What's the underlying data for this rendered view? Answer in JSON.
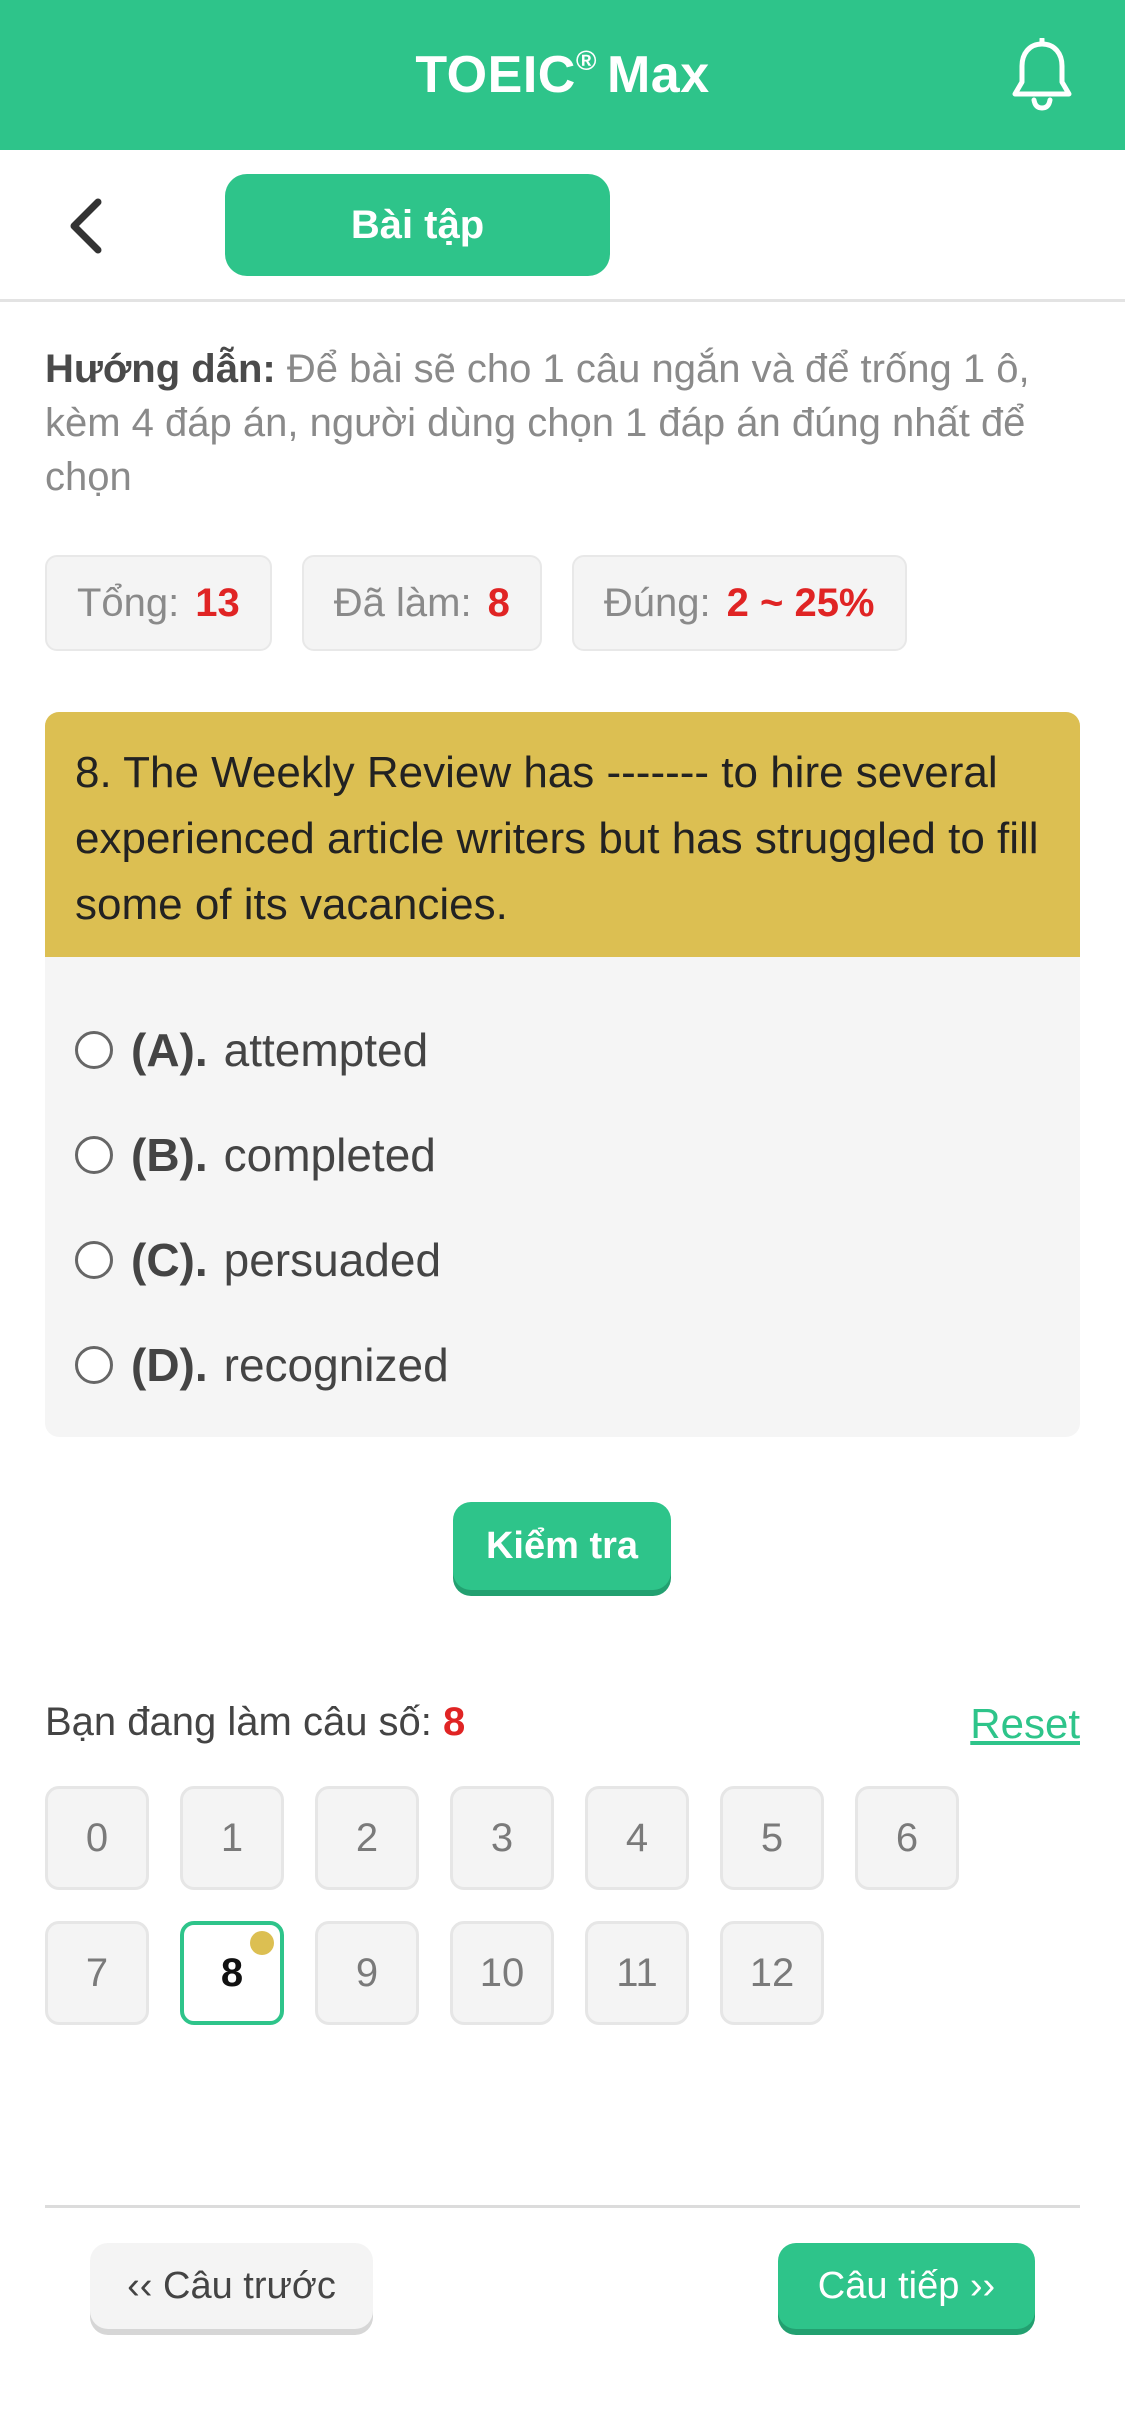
{
  "header": {
    "title": "TOEIC",
    "title_sup": "®",
    "title_suffix": "Max",
    "notification_icon": "bell-icon"
  },
  "subnav": {
    "back_icon": "chevron-left-icon",
    "tab_label": "Bài tập"
  },
  "instruction": {
    "label": "Hướng dẫn:",
    "text": "Để bài sẽ cho 1 câu ngắn và để trống 1 ô, kèm 4 đáp án, người dùng chọn 1 đáp án đúng nhất để chọn"
  },
  "stats": {
    "total_label": "Tổng:",
    "total_value": "13",
    "done_label": "Đã làm:",
    "done_value": "8",
    "correct_label": "Đúng:",
    "correct_value": "2 ~ 25%"
  },
  "question": {
    "text": "8. The Weekly Review has ------- to hire several experienced article writers but has struggled to fill some of its vacancies.",
    "options": [
      {
        "key": "(A).",
        "text": "attempted"
      },
      {
        "key": "(B).",
        "text": "completed"
      },
      {
        "key": "(C).",
        "text": "persuaded"
      },
      {
        "key": "(D).",
        "text": "recognized"
      }
    ]
  },
  "check_button": "Kiểm tra",
  "progress": {
    "label": "Bạn đang làm câu số:",
    "current": "8",
    "reset": "Reset"
  },
  "grid": [
    "0",
    "1",
    "2",
    "3",
    "4",
    "5",
    "6",
    "7",
    "8",
    "9",
    "10",
    "11",
    "12"
  ],
  "footer": {
    "prev": "‹‹ Câu trước",
    "next": "Câu tiếp ››"
  },
  "colors": {
    "brand": "#2ec48a",
    "question_bg": "#dcbf52",
    "highlight": "#e02424"
  }
}
